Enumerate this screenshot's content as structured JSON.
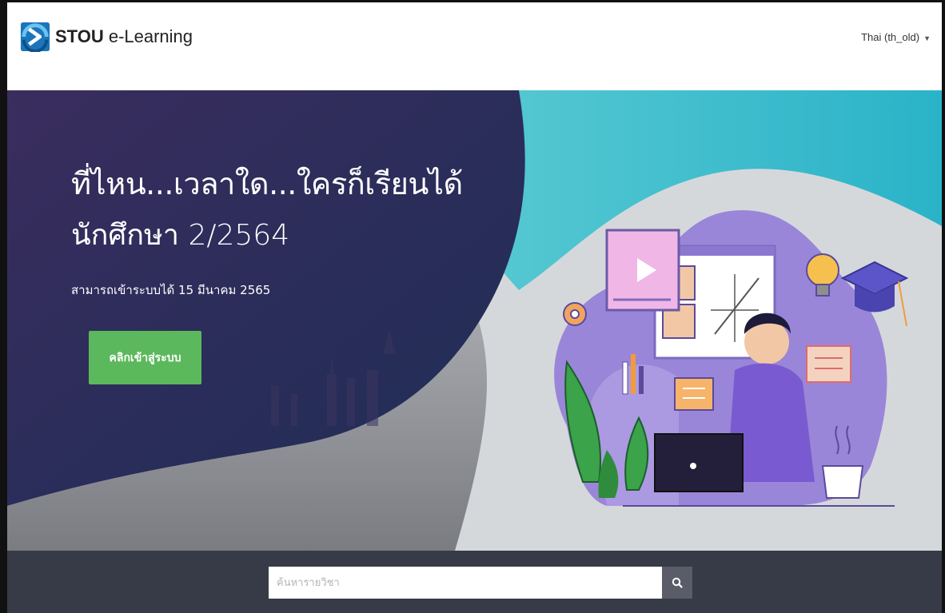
{
  "header": {
    "brand_strong": "STOU",
    "brand_rest": " e-Learning",
    "language_label": "Thai (th_old)"
  },
  "hero": {
    "title": "ที่ไหน...เวลาใด...ใครก็เรียนได้",
    "subtitle": "นักศึกษา 2/2564",
    "note": "สามารถเข้าระบบได้ 15 มีนาคม 2565",
    "button_label": "คลิกเข้าสู่ระบบ"
  },
  "search": {
    "placeholder": "ค้นหารายวิชา"
  },
  "icons": {
    "logo": "stou-logo-icon",
    "language_caret": "caret-down-icon",
    "search": "search-icon"
  },
  "colors": {
    "hero_dark": "#2a1f4a",
    "button_green": "#5cb85c",
    "search_bar": "#373a47",
    "illustration_purple": "#9a86d8"
  }
}
